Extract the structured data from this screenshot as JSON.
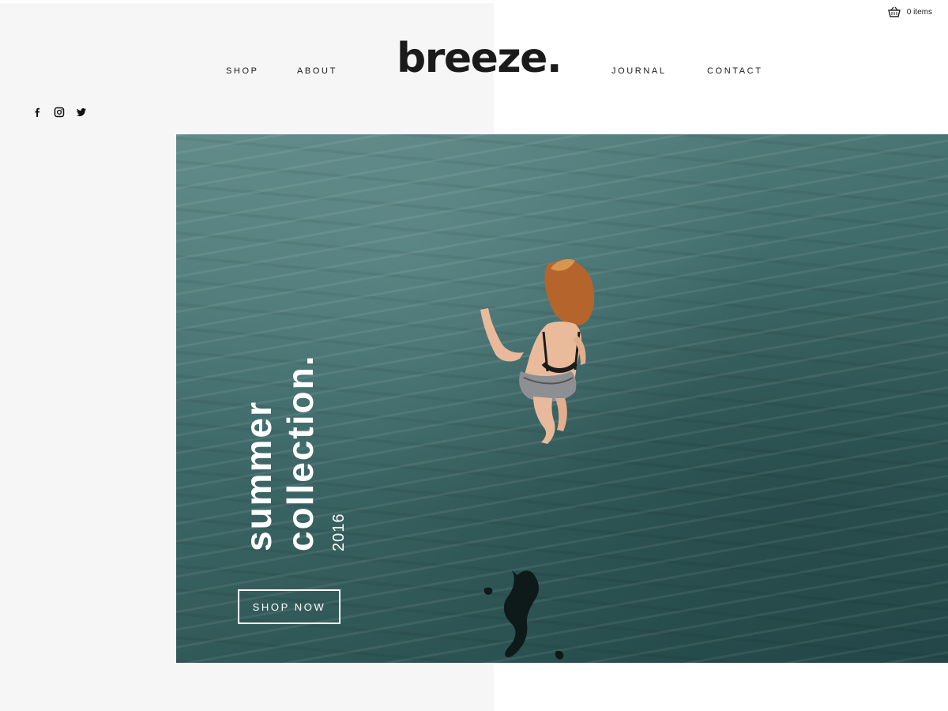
{
  "cart": {
    "count_label": "0 items",
    "icon": "basket-icon"
  },
  "brand": {
    "logo": "breeze."
  },
  "nav": {
    "shop": "SHOP",
    "about": "ABOUT",
    "journal": "JOURNAL",
    "contact": "CONTACT"
  },
  "social": [
    {
      "icon": "facebook-icon"
    },
    {
      "icon": "instagram-icon"
    },
    {
      "icon": "twitter-icon"
    }
  ],
  "hero": {
    "line1": "summer",
    "line2": "collection.",
    "year": "2016",
    "cta": "SHOP NOW"
  },
  "colors": {
    "panel": "#f6f6f6",
    "text": "#1a1a1a",
    "water": "#3f6b6a"
  }
}
